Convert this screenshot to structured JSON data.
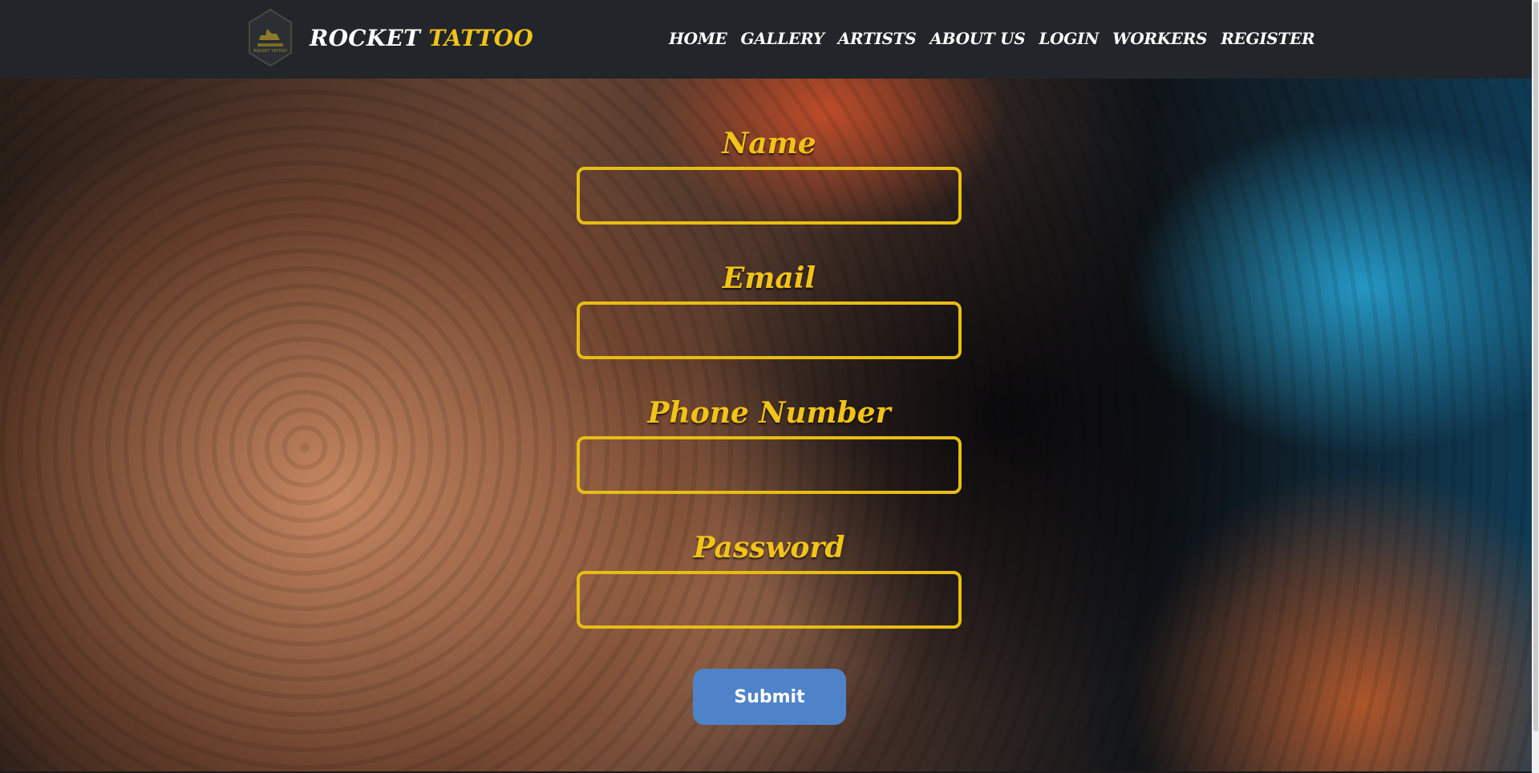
{
  "header": {
    "logo_icon": "rocket-badge-logo",
    "logo_text": "ROCKET TATTOO",
    "brand_part1": "ROCKET",
    "brand_part2": "TATTOO",
    "nav": [
      {
        "label": "HOME"
      },
      {
        "label": "GALLERY"
      },
      {
        "label": "ARTISTS"
      },
      {
        "label": "ABOUT US"
      },
      {
        "label": "LOGIN"
      },
      {
        "label": "WORKERS"
      },
      {
        "label": "REGISTER"
      }
    ]
  },
  "form": {
    "fields": [
      {
        "label": "Name",
        "value": ""
      },
      {
        "label": "Email",
        "value": ""
      },
      {
        "label": "Phone Number",
        "value": ""
      },
      {
        "label": "Password",
        "value": ""
      }
    ],
    "submit_label": "Submit"
  },
  "colors": {
    "header_bg": "#222529",
    "accent_yellow": "#f2c318",
    "submit_blue": "#4f83c9"
  }
}
